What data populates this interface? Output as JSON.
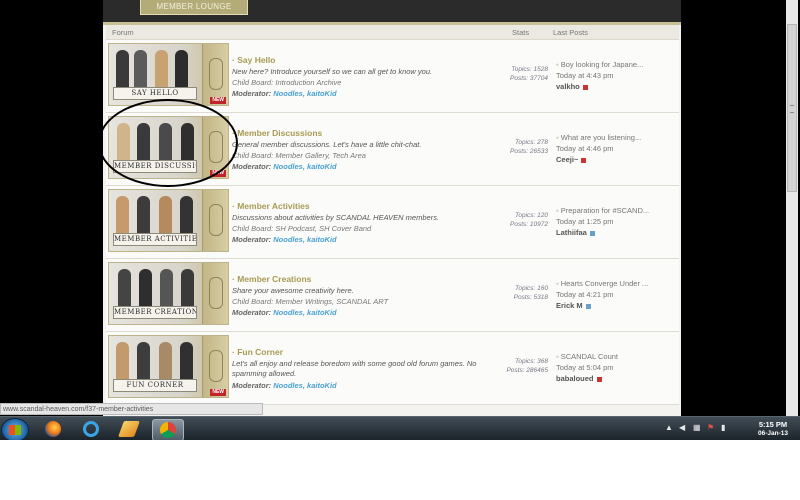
{
  "browser": {
    "status_url": "www.scandal-heaven.com/f37-member-activities"
  },
  "forum_page": {
    "lounge_tab": "MEMBER LOUNGE",
    "columns": {
      "forum": "Forum",
      "stats": "Stats",
      "last_posts": "Last Posts"
    },
    "forums": [
      {
        "thumb_label": "SAY HELLO",
        "title": "Say Hello",
        "description": "New here? Introduce yourself so we can all get to know you.",
        "child_boards": "Child Board: Introduction Archive",
        "moderator_label": "Moderator:",
        "moderators": "Noodles, kaitoKid",
        "topics": "Topics: 1528",
        "posts": "Posts: 37704",
        "last_post_title": "Boy looking for Japane...",
        "last_post_date": "Today at 4:43 pm",
        "last_post_user": "valkho",
        "has_new": true
      },
      {
        "thumb_label": "MEMBER DISCUSSIONS",
        "title": "Member Discussions",
        "description": "General member discussions. Let's have a little chit-chat.",
        "child_boards": "Child Board: Member Gallery, Tech Area",
        "moderator_label": "Moderator:",
        "moderators": "Noodles, kaitoKid",
        "topics": "Topics: 278",
        "posts": "Posts: 26533",
        "last_post_title": "What are you listening...",
        "last_post_date": "Today at 4:46 pm",
        "last_post_user": "Ceeji~",
        "has_new": true
      },
      {
        "thumb_label": "MEMBER ACTIVITIES",
        "title": "Member Activities",
        "description": "Discussions about activities by SCANDAL HEAVEN members.",
        "child_boards": "Child Board: SH Podcast, SH Cover Band",
        "moderator_label": "Moderator:",
        "moderators": "Noodles, kaitoKid",
        "topics": "Topics: 120",
        "posts": "Posts: 10972",
        "last_post_title": "Preparation for #SCAND...",
        "last_post_date": "Today at 1:25 pm",
        "last_post_user": "Lathiifaa",
        "has_new": false
      },
      {
        "thumb_label": "MEMBER CREATIONS",
        "title": "Member Creations",
        "description": "Share your awesome creativity here.",
        "child_boards": "Child Board: Member Writings, SCANDAL ART",
        "moderator_label": "Moderator:",
        "moderators": "Noodles, kaitoKid",
        "topics": "Topics: 160",
        "posts": "Posts: 5318",
        "last_post_title": "Hearts Converge Under ...",
        "last_post_date": "Today at 4:21 pm",
        "last_post_user": "Erick M",
        "has_new": false
      },
      {
        "thumb_label": "FUN CORNER",
        "title": "Fun Corner",
        "description": "Let's all enjoy and release boredom with some good old forum games. No spamming allowed.",
        "child_boards": "",
        "moderator_label": "Moderator:",
        "moderators": "Noodles, kaitoKid",
        "topics": "Topics: 368",
        "posts": "Posts: 286465",
        "last_post_title": "SCANDAL Count",
        "last_post_date": "Today at 5:04 pm",
        "last_post_user": "babaloued",
        "has_new": true
      }
    ]
  },
  "taskbar": {
    "apps": [
      "start-orb",
      "firefox",
      "internet-explorer",
      "winamp",
      "chrome"
    ],
    "clock_time": "5:15 PM",
    "clock_date": "06-Jan-13",
    "tray_icons": [
      "show-hidden-icon",
      "volume-icon",
      "network-icon",
      "flag-icon",
      "signal-icon"
    ]
  },
  "colors": {
    "accent_gold": "#a89a55",
    "moderator_blue": "#4aa1d6",
    "page_bg": "#f4f3ef",
    "new_badge": "#c0252c"
  }
}
